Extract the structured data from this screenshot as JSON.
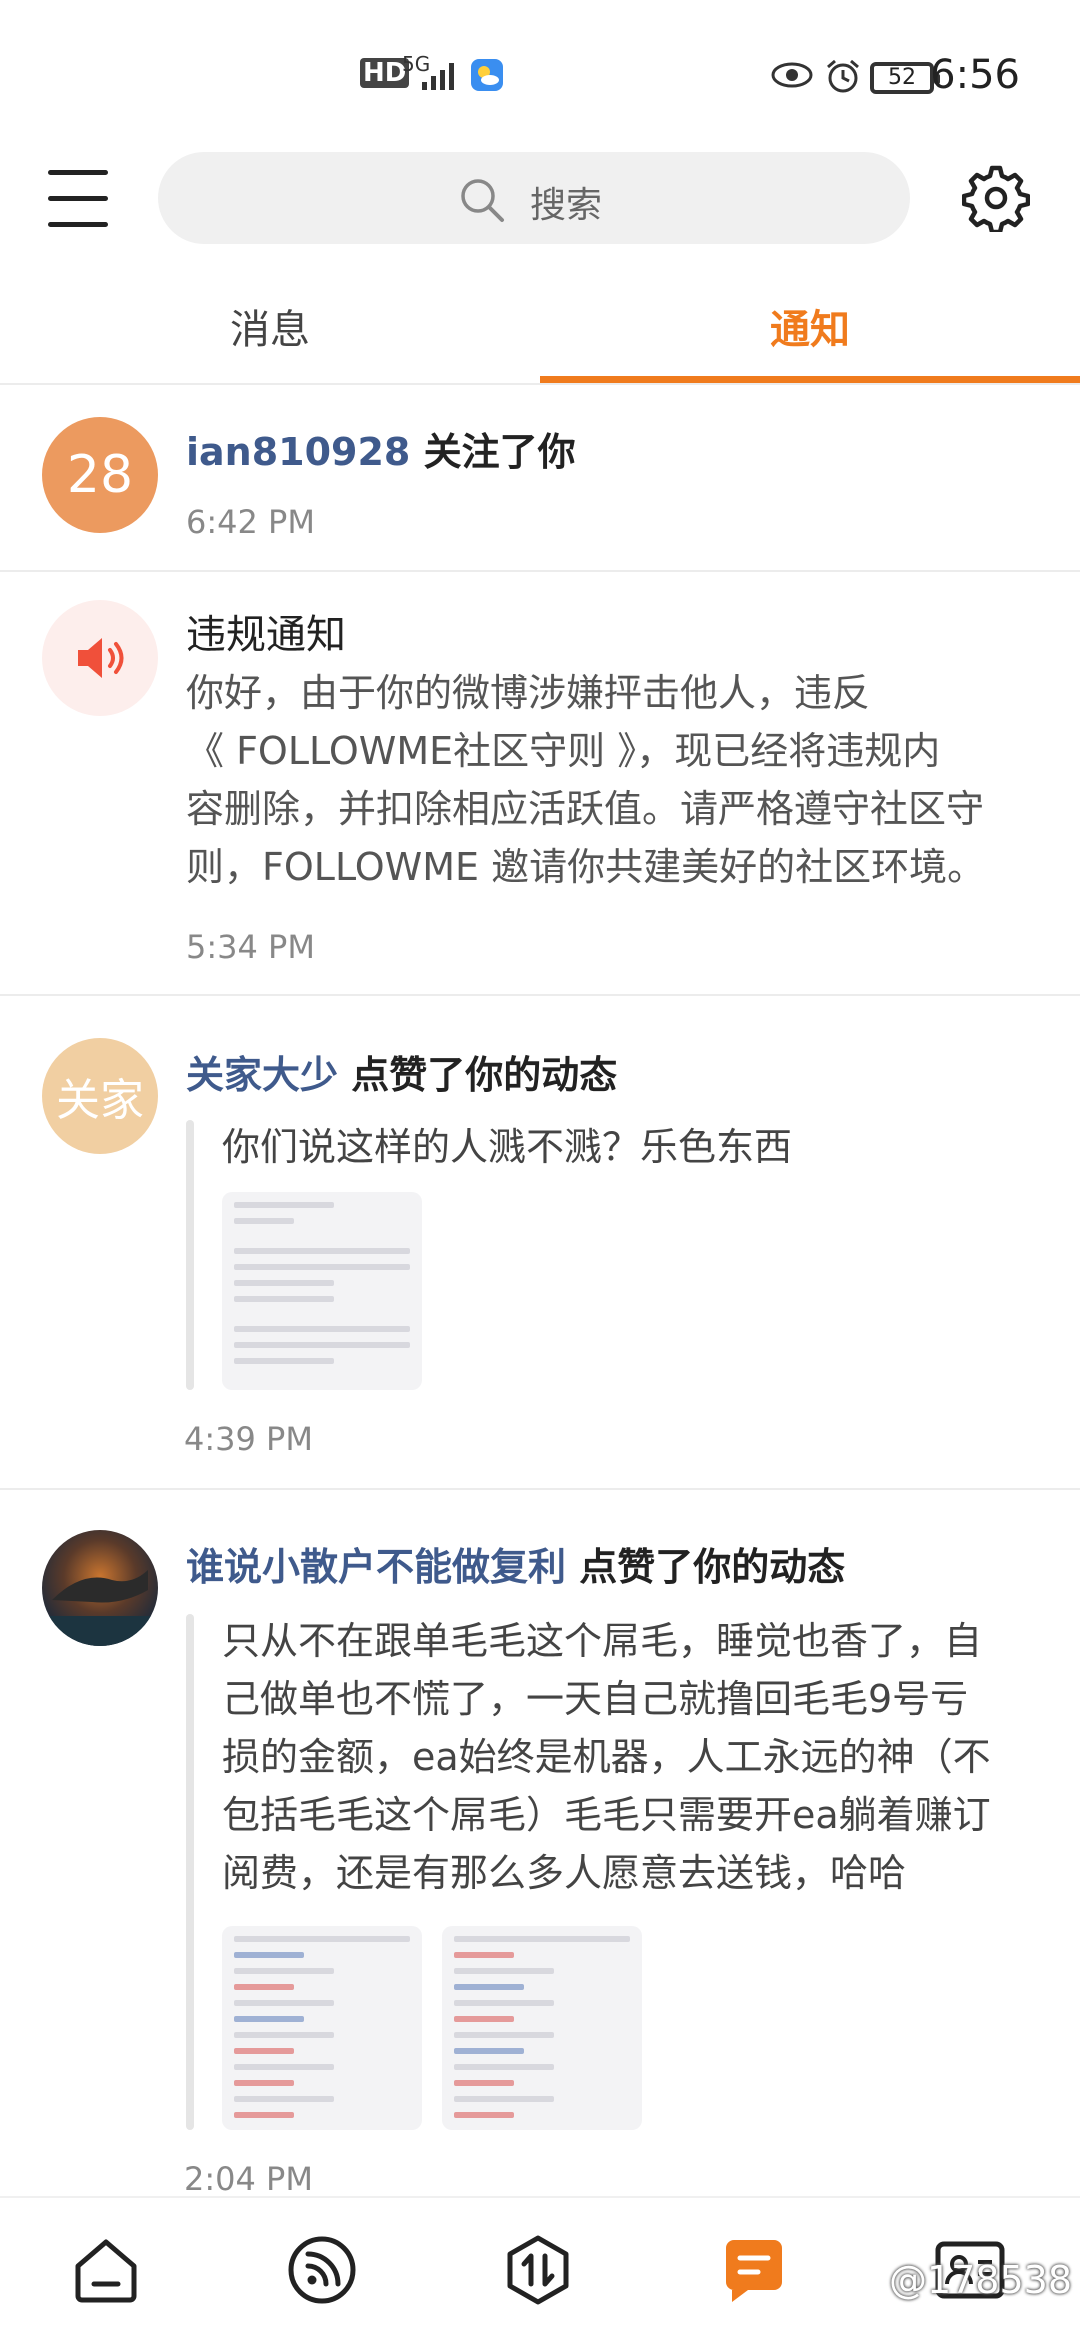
{
  "status_bar": {
    "hd": "HD",
    "network": "5G",
    "battery": "52",
    "time": "6:56"
  },
  "header": {
    "search_placeholder": "搜索"
  },
  "tabs": [
    {
      "label": "消息",
      "active": false
    },
    {
      "label": "通知",
      "active": true
    }
  ],
  "colors": {
    "accent": "#f07b1d",
    "username": "#3f5a8c"
  },
  "notifications": [
    {
      "avatar_text": "28",
      "avatar_color": "#ec9a5f",
      "user": "ian810928",
      "action": " 关注了你",
      "time": "6:42 PM"
    },
    {
      "icon": "speaker-icon",
      "title": "违规通知",
      "body": [
        "你好，由于你的微博涉嫌抨击他人，违反",
        "《 FOLLOWME社区守则 》，现已经将违规内",
        "容删除，并扣除相应活跃值。请严格遵守社区守",
        "则，FOLLOWME 邀请你共建美好的社区环境。"
      ],
      "time": "5:34 PM"
    },
    {
      "avatar_text": "关家",
      "avatar_color": "#f1cfa2",
      "user": "关家大少",
      "action": " 点赞了你的动态",
      "quote": [
        "你们说这样的人溅不溅？乐色东西"
      ],
      "time": "4:39 PM"
    },
    {
      "user": "谁说小散户不能做复利",
      "action": " 点赞了你的动态",
      "quote": [
        "只从不在跟单毛毛这个屌毛，睡觉也香了，自",
        "己做单也不慌了，一天自己就撸回毛毛9号亏",
        "损的金额，ea始终是机器，人工永远的神（不",
        "包括毛毛这个屌毛）毛毛只需要开ea躺着赚订",
        "阅费，还是有那么多人愿意去送钱，哈哈"
      ],
      "time": "2:04 PM"
    }
  ],
  "bottom_nav": [
    {
      "icon": "home-icon"
    },
    {
      "icon": "feed-icon"
    },
    {
      "icon": "trade-icon"
    },
    {
      "icon": "message-icon",
      "active": true
    },
    {
      "icon": "profile-card-icon"
    }
  ],
  "watermark": "@178538"
}
